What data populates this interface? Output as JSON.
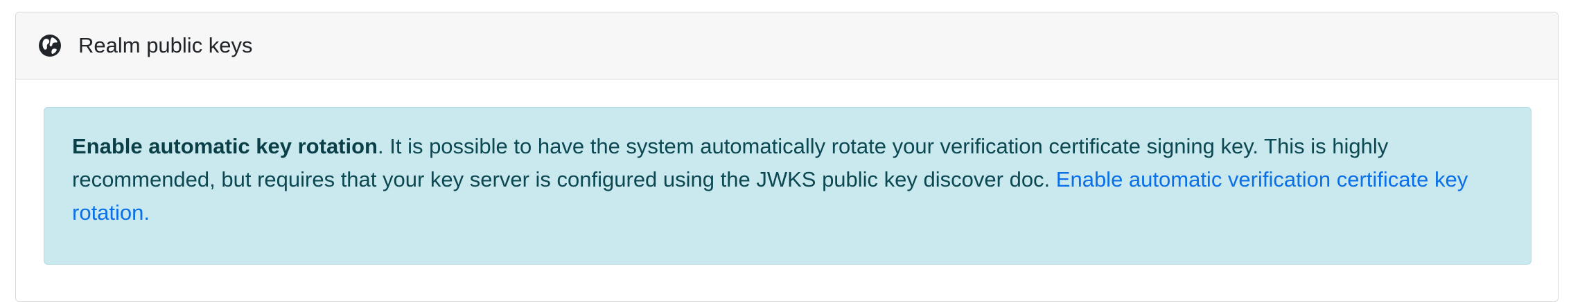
{
  "card": {
    "title": "Realm public keys",
    "icon": "globe-icon"
  },
  "alert": {
    "heading": "Enable automatic key rotation",
    "text": ". It is possible to have the system automatically rotate your verification certificate signing key. This is highly recommended, but requires that your key server is configured using the JWKS public key discover doc. ",
    "link_label": "Enable automatic verification certificate key rotation."
  },
  "colors": {
    "alert_background": "#c9e9ee",
    "alert_text": "#0b4852",
    "link": "#0b6fe6",
    "header_background": "#f7f7f7"
  }
}
